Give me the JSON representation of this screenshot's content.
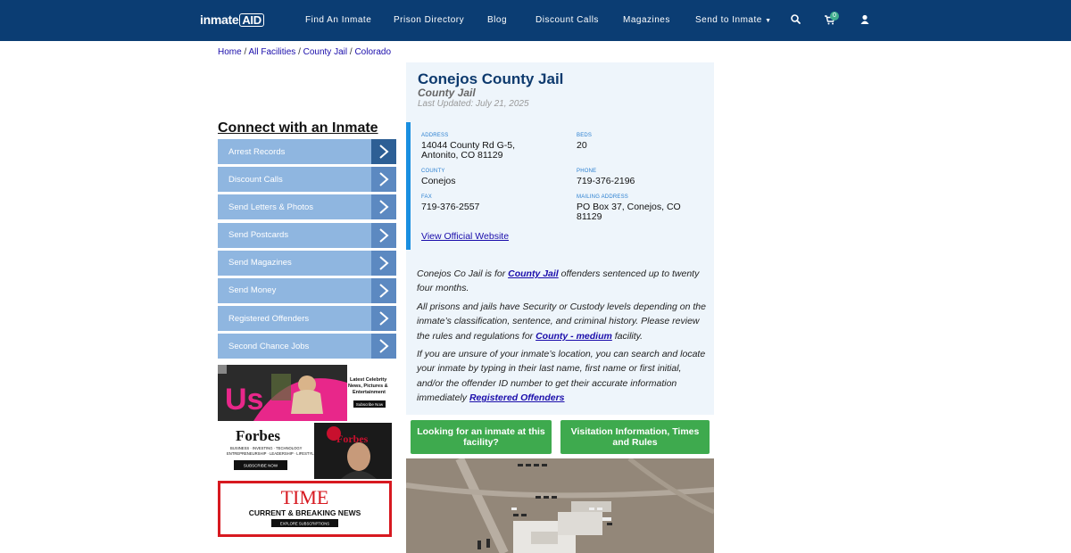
{
  "header": {
    "logo_text": "inmate",
    "logo_badge": "AID",
    "nav": [
      {
        "label": "Find An Inmate"
      },
      {
        "label": "Prison Directory"
      },
      {
        "label": "Blog"
      },
      {
        "label": "Discount Calls"
      },
      {
        "label": "Magazines"
      },
      {
        "label": "Send to Inmate"
      }
    ],
    "cart_count": "0",
    "icons": [
      "search-icon",
      "cart-icon",
      "user-icon"
    ]
  },
  "breadcrumb": {
    "items": [
      "Home",
      "All Facilities",
      "County Jail",
      "Colorado"
    ],
    "separator": "/"
  },
  "sidebar": {
    "title": "Connect with an Inmate",
    "items": [
      {
        "label": "Arrest Records"
      },
      {
        "label": "Discount Calls"
      },
      {
        "label": "Send Letters & Photos"
      },
      {
        "label": "Send Postcards"
      },
      {
        "label": "Send Magazines"
      },
      {
        "label": "Send Money"
      },
      {
        "label": "Registered Offenders"
      },
      {
        "label": "Second Chance Jobs"
      }
    ],
    "ads": {
      "us": {
        "logo": "Us",
        "text1": "Latest Celebrity",
        "text2": "News, Pictures &",
        "text3": "Entertainment",
        "cta": "Subscribe Now"
      },
      "forbes": {
        "logo": "Forbes",
        "tag1": "BUSINESS · INVESTING · TECHNOLOGY",
        "tag2": "ENTREPRENEURSHIP · LEADERSHIP · LIFESTYLE",
        "cta": "SUBSCRIBE NOW",
        "cover": "Forbes"
      },
      "time": {
        "logo": "TIME",
        "tagline": "CURRENT & BREAKING NEWS",
        "cta": "EXPLORE SUBSCRIPTIONS"
      }
    }
  },
  "facility": {
    "name": "Conejos County Jail",
    "type": "County Jail",
    "updated": "Last Updated: July 21, 2025",
    "fields": {
      "address_label": "ADDRESS",
      "address_line1": "14044 County Rd G-5,",
      "address_line2": "Antonito, CO 81129",
      "beds_label": "BEDS",
      "beds": "20",
      "county_label": "COUNTY",
      "county": "Conejos",
      "phone_label": "PHONE",
      "phone": "719-376-2196",
      "fax_label": "FAX",
      "fax": "719-376-2557",
      "mailing_label": "MAILING ADDRESS",
      "mailing_line1": "PO Box 37, Conejos, CO",
      "mailing_line2": "81129"
    },
    "official_link": "View Official Website",
    "desc1_a": "Conejos Co Jail is for ",
    "desc1_link": "County Jail",
    "desc1_b": " offenders sentenced up to twenty four months.",
    "desc2_a": "All prisons and jails have Security or Custody levels depending on the inmate’s classification, sentence, and criminal history. Please review the rules and regulations for ",
    "desc2_link": "County - medium",
    "desc2_b": " facility.",
    "desc3_a": "If you are unsure of your inmate’s location, you can search and locate your inmate by typing in their last name, first name or first initial, and/or the offender ID number to get their accurate information immediately ",
    "desc3_link": "Registered Offenders",
    "buttons": {
      "lookup": "Looking for an inmate at this facility?",
      "visitation": "Visitation Information, Times and Rules"
    }
  },
  "colors": {
    "nav_bg": "#0b3d73",
    "panel_bg": "#eef5fb",
    "accent_blue": "#1a8fe0",
    "button_green": "#3eaa4e",
    "side_item": "#8fb6e0"
  }
}
